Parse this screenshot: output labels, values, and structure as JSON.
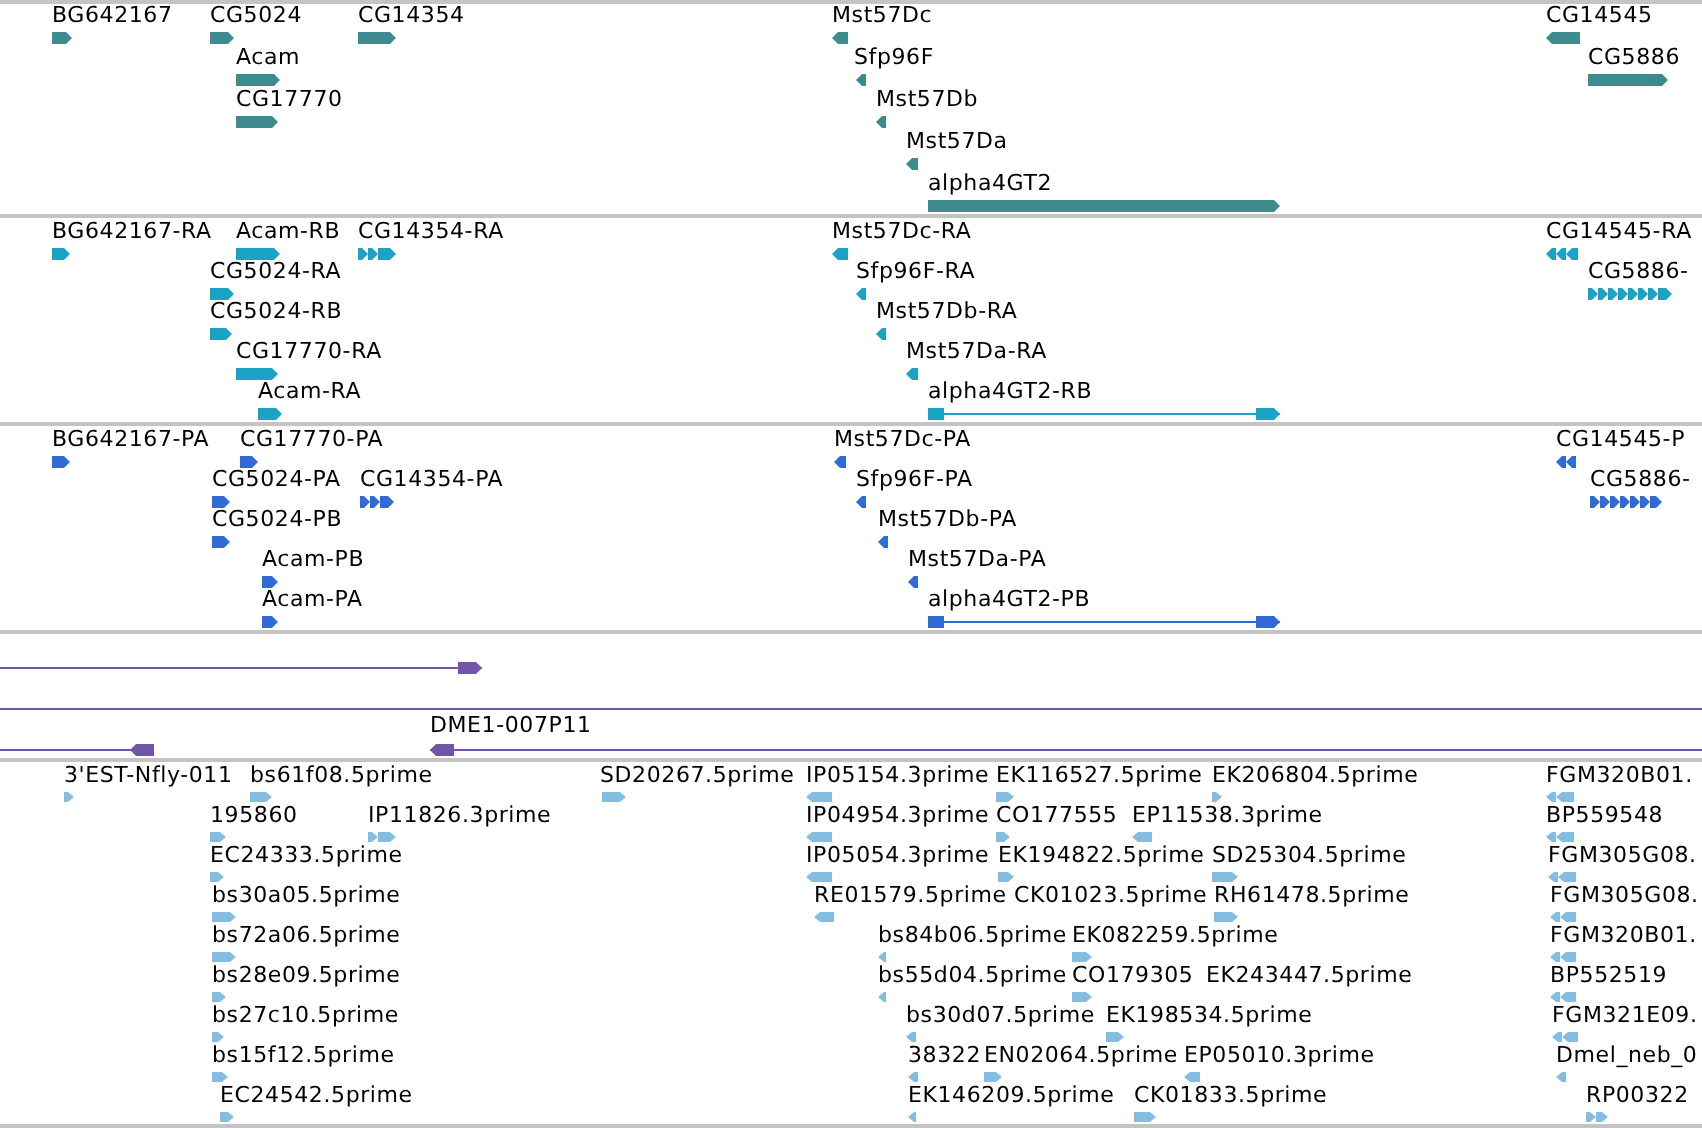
{
  "tracks": [
    {
      "kind": "gene",
      "color": "#3d8b8f",
      "features": [
        {
          "label": "BG642167",
          "reverse": false
        },
        {
          "label": "CG5024",
          "reverse": false
        },
        {
          "label": "CG14354",
          "reverse": false
        },
        {
          "label": "Mst57Dc",
          "reverse": true
        },
        {
          "label": "CG14545",
          "reverse": true
        },
        {
          "label": "Acam",
          "reverse": false
        },
        {
          "label": "Sfp96F",
          "reverse": true
        },
        {
          "label": "CG5886",
          "reverse": false
        },
        {
          "label": "CG17770",
          "reverse": false
        },
        {
          "label": "Mst57Db",
          "reverse": true
        },
        {
          "label": "Mst57Da",
          "reverse": true
        },
        {
          "label": "alpha4GT2",
          "reverse": false
        }
      ]
    },
    {
      "kind": "transcript",
      "color": "#1aa3c4",
      "features": [
        {
          "label": "BG642167-RA",
          "reverse": false
        },
        {
          "label": "Acam-RB",
          "reverse": false
        },
        {
          "label": "CG14354-RA",
          "reverse": false
        },
        {
          "label": "Mst57Dc-RA",
          "reverse": true
        },
        {
          "label": "CG14545-RA",
          "reverse": true
        },
        {
          "label": "CG5024-RA",
          "reverse": false
        },
        {
          "label": "Sfp96F-RA",
          "reverse": true
        },
        {
          "label": "CG5886-",
          "reverse": false
        },
        {
          "label": "CG5024-RB",
          "reverse": false
        },
        {
          "label": "Mst57Db-RA",
          "reverse": true
        },
        {
          "label": "CG17770-RA",
          "reverse": false
        },
        {
          "label": "Mst57Da-RA",
          "reverse": true
        },
        {
          "label": "Acam-RA",
          "reverse": false
        },
        {
          "label": "alpha4GT2-RB",
          "reverse": false
        }
      ]
    },
    {
      "kind": "protein",
      "color": "#2f6ad6",
      "features": [
        {
          "label": "BG642167-PA",
          "reverse": false
        },
        {
          "label": "CG17770-PA",
          "reverse": false
        },
        {
          "label": "Mst57Dc-PA",
          "reverse": true
        },
        {
          "label": "CG14545-P",
          "reverse": true
        },
        {
          "label": "CG5024-PA",
          "reverse": false
        },
        {
          "label": "CG14354-PA",
          "reverse": false
        },
        {
          "label": "Sfp96F-PA",
          "reverse": true
        },
        {
          "label": "CG5886-",
          "reverse": false
        },
        {
          "label": "CG5024-PB",
          "reverse": false
        },
        {
          "label": "Mst57Db-PA",
          "reverse": true
        },
        {
          "label": "Acam-PB",
          "reverse": false
        },
        {
          "label": "Mst57Da-PA",
          "reverse": true
        },
        {
          "label": "Acam-PA",
          "reverse": false
        },
        {
          "label": "alpha4GT2-PB",
          "reverse": false
        }
      ]
    },
    {
      "kind": "clone",
      "color": "#7355a8",
      "features": [
        {
          "reverse": false
        },
        {
          "reverse": true
        },
        {
          "label": "DME1-007P11",
          "reverse": true
        }
      ]
    },
    {
      "kind": "est",
      "color": "#85bde0",
      "features": [
        {
          "label": "3'EST-Nfly-011",
          "reverse": false
        },
        {
          "label": "bs61f08.5prime",
          "reverse": false
        },
        {
          "label": "SD20267.5prime",
          "reverse": false
        },
        {
          "label": "IP05154.3prime",
          "reverse": true
        },
        {
          "label": "EK116527.5prime",
          "reverse": false
        },
        {
          "label": "EK206804.5prime",
          "reverse": false
        },
        {
          "label": "FGM320B01.",
          "reverse": true
        },
        {
          "label": "195860",
          "reverse": false
        },
        {
          "label": "IP11826.3prime",
          "reverse": false
        },
        {
          "label": "IP04954.3prime",
          "reverse": true
        },
        {
          "label": "CO177555",
          "reverse": false
        },
        {
          "label": "EP11538.3prime",
          "reverse": true
        },
        {
          "label": "BP559548",
          "reverse": true
        },
        {
          "label": "EC24333.5prime",
          "reverse": false
        },
        {
          "label": "IP05054.3prime",
          "reverse": true
        },
        {
          "label": "EK194822.5prime",
          "reverse": false
        },
        {
          "label": "SD25304.5prime",
          "reverse": false
        },
        {
          "label": "FGM305G08.",
          "reverse": true
        },
        {
          "label": "bs30a05.5prime",
          "reverse": false
        },
        {
          "label": "RE01579.5prime",
          "reverse": true
        },
        {
          "label": "CK01023.5prime"
        },
        {
          "label": "RH61478.5prime",
          "reverse": false
        },
        {
          "label": "FGM305G08.",
          "reverse": true
        },
        {
          "label": "bs72a06.5prime",
          "reverse": false
        },
        {
          "label": "bs84b06.5prime",
          "reverse": true
        },
        {
          "label": "EK082259.5prime",
          "reverse": false
        },
        {
          "label": "FGM320B01.",
          "reverse": true
        },
        {
          "label": "bs28e09.5prime",
          "reverse": false
        },
        {
          "label": "bs55d04.5prime",
          "reverse": true
        },
        {
          "label": "CO179305",
          "reverse": false
        },
        {
          "label": "EK243447.5prime"
        },
        {
          "label": "BP552519",
          "reverse": true
        },
        {
          "label": "bs27c10.5prime",
          "reverse": false
        },
        {
          "label": "bs30d07.5prime",
          "reverse": true
        },
        {
          "label": "EK198534.5prime",
          "reverse": false
        },
        {
          "label": "FGM321E09.",
          "reverse": true
        },
        {
          "label": "bs15f12.5prime",
          "reverse": false
        },
        {
          "label": "38322",
          "reverse": true
        },
        {
          "label": "EN02064.5prime",
          "reverse": false
        },
        {
          "label": "EP05010.3prime",
          "reverse": true
        },
        {
          "label": "Dmel_neb_0",
          "reverse": true
        },
        {
          "label": "EC24542.5prime",
          "reverse": false
        },
        {
          "label": "EK146209.5prime",
          "reverse": true
        },
        {
          "label": "CK01833.5prime",
          "reverse": false
        },
        {
          "label": "RP00322",
          "reverse": false
        }
      ]
    }
  ]
}
